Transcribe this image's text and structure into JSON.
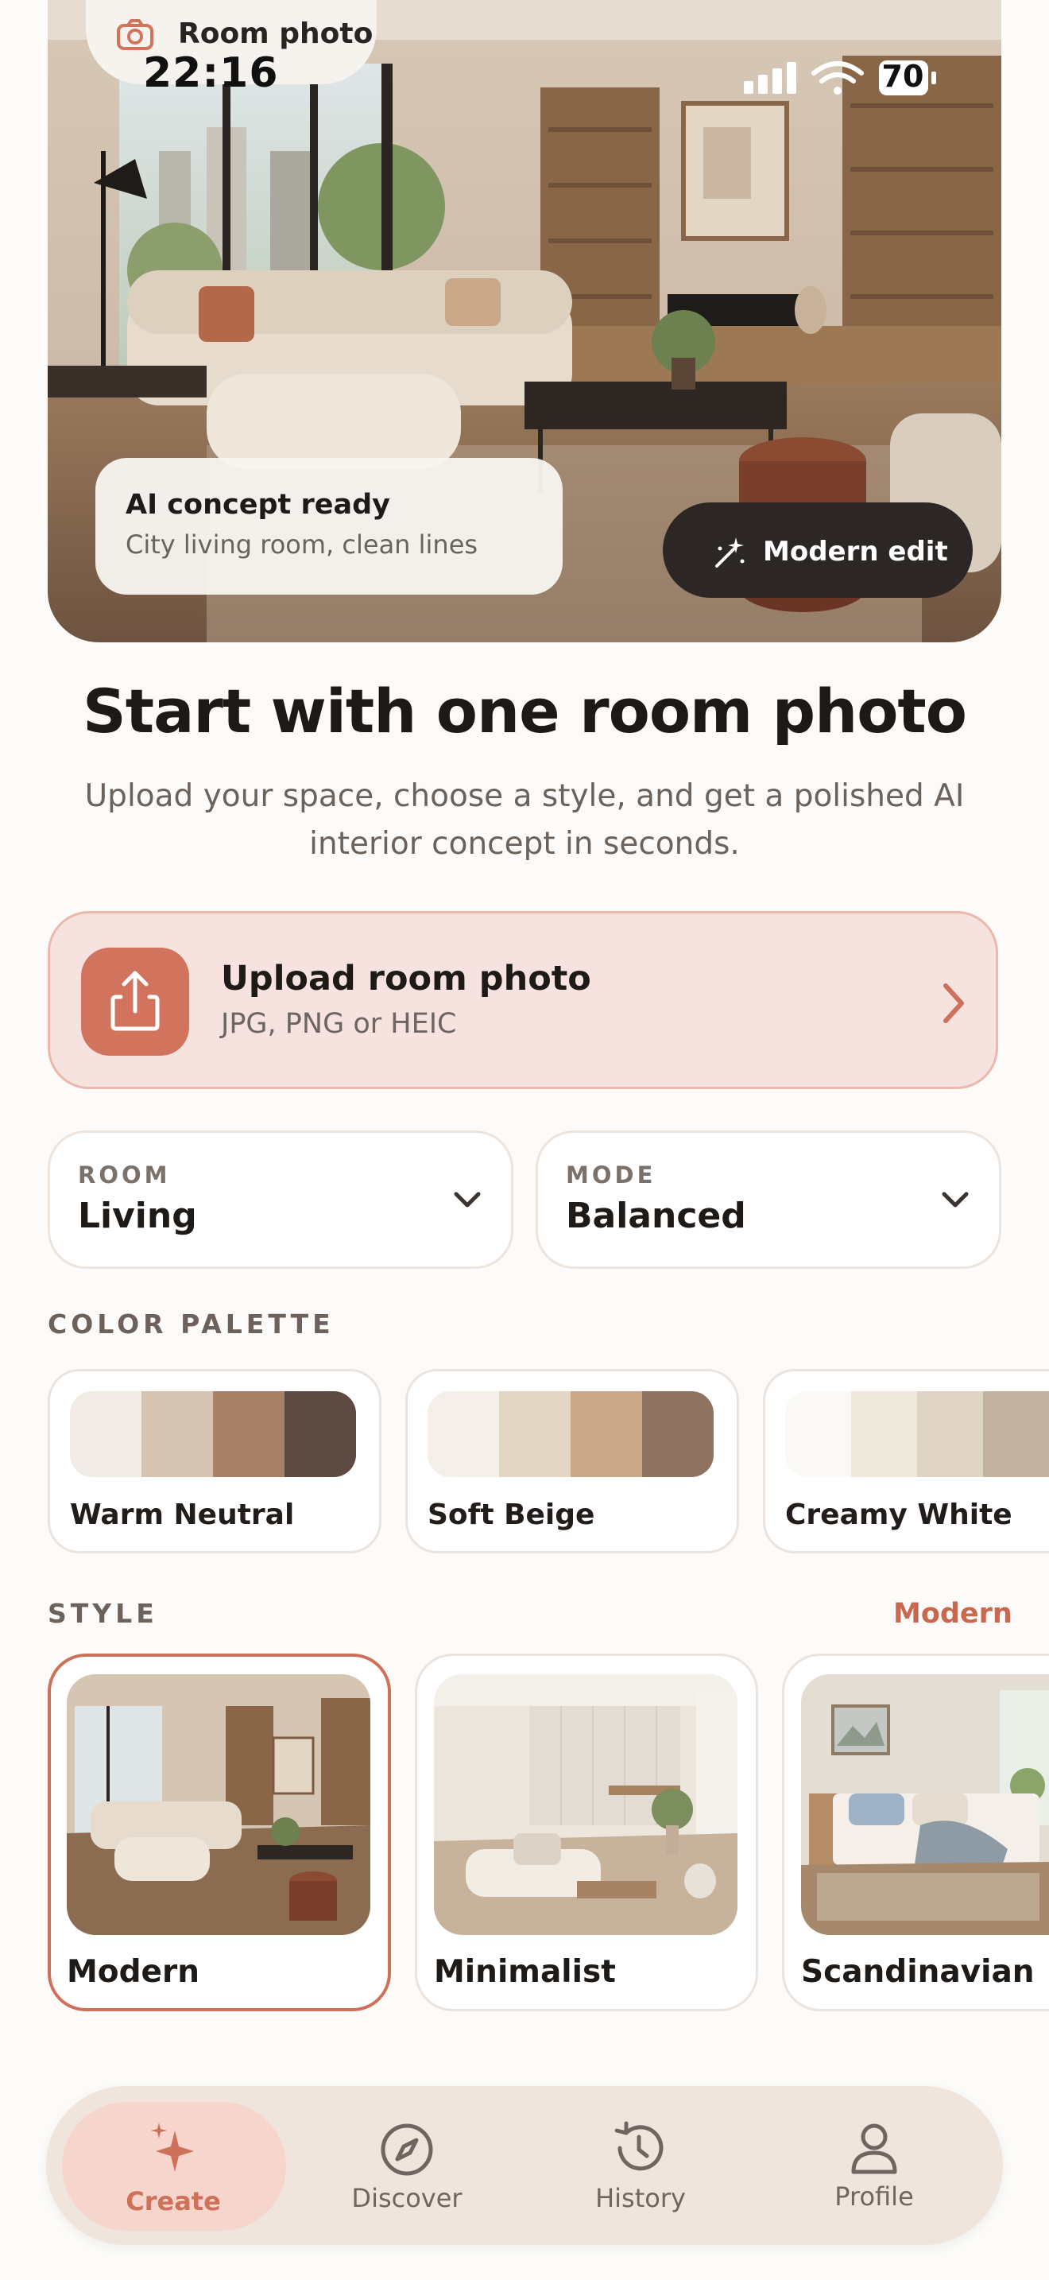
{
  "status_bar": {
    "time": "22:16",
    "battery": "70",
    "room_pill_label": "Room photo"
  },
  "hero": {
    "concept_title": "AI concept ready",
    "concept_subtitle": "City living room, clean lines",
    "modern_edit_label": "Modern edit"
  },
  "intro": {
    "title": "Start with one room photo",
    "subtitle": "Upload your space, choose a style, and get a polished AI interior concept in seconds."
  },
  "upload": {
    "title": "Upload room photo",
    "subtitle": "JPG, PNG or HEIC"
  },
  "selects": {
    "room": {
      "label": "ROOM",
      "value": "Living"
    },
    "mode": {
      "label": "MODE",
      "value": "Balanced"
    }
  },
  "palette": {
    "section_label": "COLOR PALETTE",
    "items": [
      {
        "name": "Warm Neutral",
        "colors": [
          "#f0ebe4",
          "#d6c4b3",
          "#a88168",
          "#5d4a42"
        ]
      },
      {
        "name": "Soft Beige",
        "colors": [
          "#f5efea",
          "#e4d6c5",
          "#c9a987",
          "#8d7360"
        ]
      },
      {
        "name": "Creamy White",
        "colors": [
          "#fbf9f6",
          "#efe8dd",
          "#e0d4c4",
          "#c3b29f"
        ]
      }
    ]
  },
  "style": {
    "section_label": "STYLE",
    "selected_label": "Modern",
    "items": [
      {
        "name": "Modern",
        "selected": true
      },
      {
        "name": "Minimalist",
        "selected": false
      },
      {
        "name": "Scandinavian",
        "selected": false
      }
    ]
  },
  "tabs": [
    {
      "label": "Create",
      "icon": "sparkles-icon",
      "active": true
    },
    {
      "label": "Discover",
      "icon": "compass-icon",
      "active": false
    },
    {
      "label": "History",
      "icon": "history-icon",
      "active": false
    },
    {
      "label": "Profile",
      "icon": "person-icon",
      "active": false
    }
  ],
  "colors": {
    "accent": "#cf705a",
    "upload_bg": "#f6e3df",
    "tab_active_bg": "#f6d6cc",
    "dark_pill": "#2c2724"
  }
}
